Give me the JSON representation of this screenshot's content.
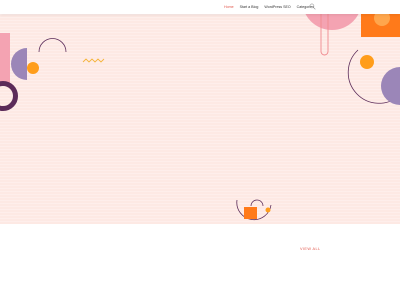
{
  "nav": {
    "items": [
      {
        "label": "Home",
        "active": true
      },
      {
        "label": "Start a Blog",
        "active": false
      },
      {
        "label": "WordPress SEO",
        "active": false
      },
      {
        "label": "Categories",
        "active": false
      }
    ],
    "search_icon": "search-icon"
  },
  "section": {
    "view_all_label": "VIEW ALL"
  },
  "colors": {
    "accent": "#e2574c",
    "hero_bg": "#fde9e4",
    "orange": "#ff7a1a",
    "purple": "#9b86b8",
    "pink": "#f4a3b2",
    "dark_purple": "#5b2b59"
  }
}
